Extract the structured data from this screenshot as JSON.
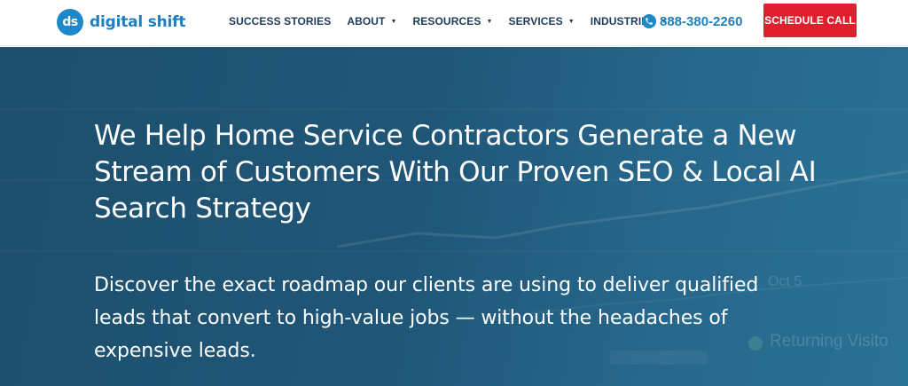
{
  "brand": {
    "mark": "ds",
    "name": "digital shift",
    "color": "#1e88c8"
  },
  "nav": {
    "items": [
      {
        "label": "SUCCESS STORIES",
        "dropdown": false
      },
      {
        "label": "ABOUT",
        "dropdown": true
      },
      {
        "label": "RESOURCES",
        "dropdown": true
      },
      {
        "label": "SERVICES",
        "dropdown": true
      },
      {
        "label": "INDUSTRIES",
        "dropdown": true
      }
    ],
    "caret_icon": "chevron-down-icon"
  },
  "contact": {
    "phone_icon": "phone-icon",
    "phone": "888-380-2260"
  },
  "cta": {
    "label": "SCHEDULE CALL",
    "color": "#e01e2d"
  },
  "hero": {
    "headline": "We Help Home Service Contractors Generate a New Stream of Customers With Our Proven SEO & Local AI Search Strategy",
    "subtext": "Discover the exact roadmap our clients are using to deliver qualified leads that convert to high-value jobs — without the headaches of expensive leads.",
    "background_labels": {
      "date": "Oct 5",
      "legend": "Returning Visito"
    },
    "background_color": "#1f5677"
  }
}
